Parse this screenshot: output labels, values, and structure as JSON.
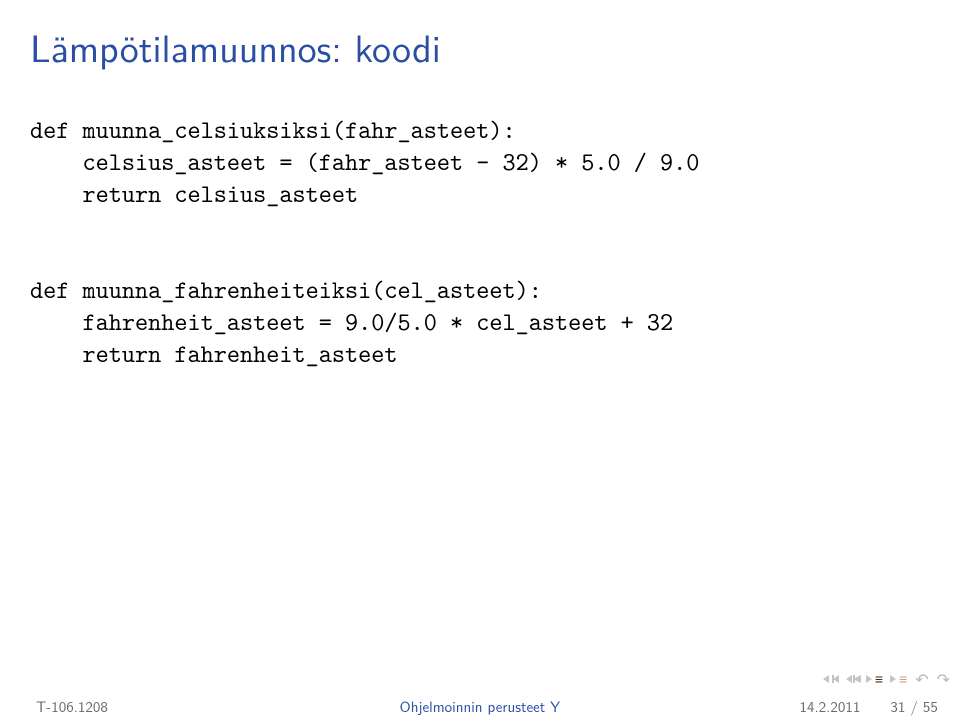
{
  "title": "Lämpötilamuunnos: koodi",
  "code": {
    "line1": "def muunna_celsiuksiksi(fahr_asteet):",
    "line2": "    celsius_asteet = (fahr_asteet - 32) * 5.0 / 9.0",
    "line3": "    return celsius_asteet",
    "line4": "",
    "line5": "",
    "line6": "def muunna_fahrenheiteiksi(cel_asteet):",
    "line7": "    fahrenheit_asteet = 9.0/5.0 * cel_asteet + 32",
    "line8": "    return fahrenheit_asteet"
  },
  "footer": {
    "left": "T-106.1208",
    "center": "Ohjelmoinnin perusteet Y",
    "date": "14.2.2011",
    "page": "31 / 55"
  },
  "icons": {
    "nav_first": "nav-first-icon",
    "nav_prev": "nav-prev-icon",
    "nav_next": "nav-next-icon",
    "nav_last": "nav-last-icon",
    "lines": "lines-icon",
    "undo": "undo-icon",
    "redo": "redo-icon"
  }
}
